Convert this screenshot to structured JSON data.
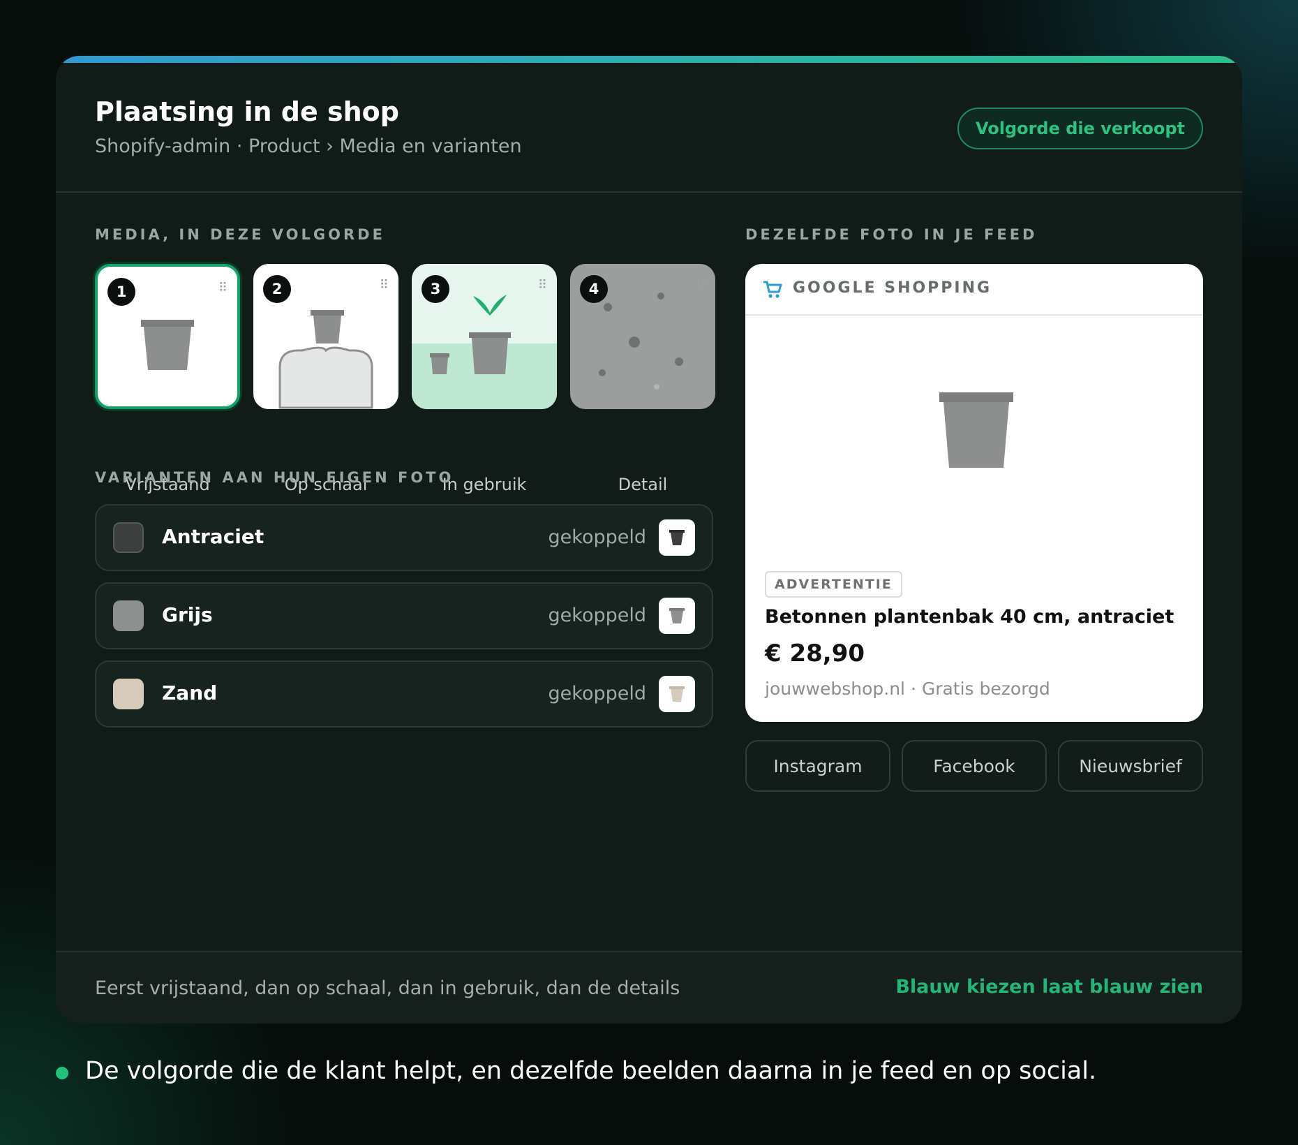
{
  "header": {
    "title": "Plaatsing in de shop",
    "subtitle": "Shopify-admin · Product › Media en varianten",
    "badge": "Volgorde die verkoopt"
  },
  "media": {
    "section_label": "MEDIA, IN DEZE VOLGORDE",
    "items": [
      {
        "number": "1",
        "label": "Vrijstaand",
        "selected": true
      },
      {
        "number": "2",
        "label": "Op schaal",
        "selected": false
      },
      {
        "number": "3",
        "label": "In gebruik",
        "selected": false
      },
      {
        "number": "4",
        "label": "Detail",
        "selected": false
      }
    ]
  },
  "variants": {
    "section_label": "VARIANTEN AAN HUN EIGEN FOTO",
    "items": [
      {
        "name": "Antraciet",
        "status": "gekoppeld",
        "color": "#3c3f3e"
      },
      {
        "name": "Grijs",
        "status": "gekoppeld",
        "color": "#8d908f"
      },
      {
        "name": "Zand",
        "status": "gekoppeld",
        "color": "#d6cbba"
      }
    ]
  },
  "feed": {
    "section_label": "DEZELFDE FOTO IN JE FEED",
    "channel": "GOOGLE SHOPPING",
    "ad_badge": "ADVERTENTIE",
    "product_name": "Betonnen plantenbak 40 cm, antraciet",
    "price": "€ 28,90",
    "meta": "jouwwebshop.nl · Gratis bezorgd",
    "social": [
      "Instagram",
      "Facebook",
      "Nieuwsbrief"
    ]
  },
  "footer": {
    "left": "Eerst vrijstaand, dan op schaal, dan in gebruik, dan de details",
    "right": "Blauw kiezen laat blauw zien"
  },
  "caption": "De volgorde die de klant helpt, en dezelfde beelden daarna in je feed en op social.",
  "colors": {
    "accent": "#2bc47f",
    "gradient_start": "#2d9bd4",
    "gradient_end": "#26c48a",
    "card_bg": "#111c19"
  },
  "icons": [
    "drag-handle-icon",
    "pot-icon",
    "plant-icon",
    "cart-icon"
  ]
}
